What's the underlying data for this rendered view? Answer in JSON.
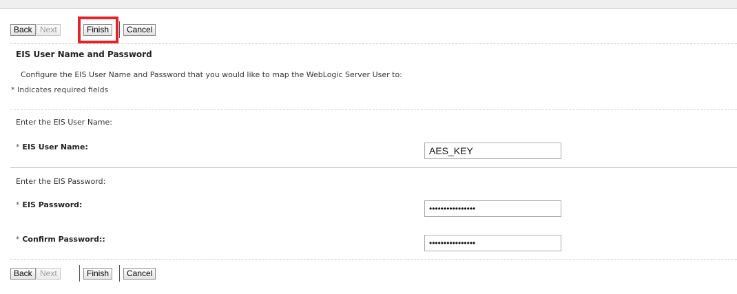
{
  "buttons": {
    "back": "Back",
    "next": "Next",
    "finish": "Finish",
    "cancel": "Cancel"
  },
  "section": {
    "title": "EIS User Name and Password",
    "description": "Configure the EIS User Name and Password that you would like to map the WebLogic Server User to:",
    "required_note": "* Indicates required fields"
  },
  "username_block": {
    "prompt": "Enter the EIS User Name:",
    "label": "EIS User Name:",
    "value": "AES_KEY"
  },
  "password_block": {
    "prompt": "Enter the EIS Password:",
    "label": "EIS Password:",
    "value": "••••••••••••••••",
    "confirm_label": "Confirm Password::",
    "confirm_value": "••••••••••••••••"
  },
  "required_marker": "*",
  "colors": {
    "highlight": "#e3222c"
  }
}
